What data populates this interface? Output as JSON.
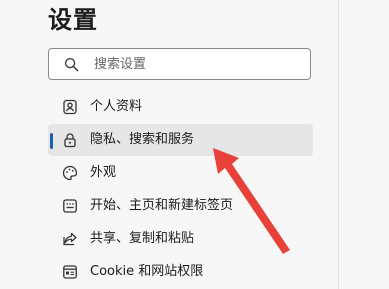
{
  "settings": {
    "title": "设置",
    "search_placeholder": "搜索设置"
  },
  "menu": {
    "items": [
      {
        "label": "个人资料",
        "icon": "profile-icon",
        "active": false
      },
      {
        "label": "隐私、搜索和服务",
        "icon": "lock-icon",
        "active": true
      },
      {
        "label": "外观",
        "icon": "palette-icon",
        "active": false
      },
      {
        "label": "开始、主页和新建标签页",
        "icon": "new-tab-icon",
        "active": false
      },
      {
        "label": "共享、复制和粘贴",
        "icon": "share-icon",
        "active": false
      },
      {
        "label": "Cookie 和网站权限",
        "icon": "site-permissions-icon",
        "active": false
      }
    ]
  },
  "colors": {
    "active_indicator": "#1a5fb4",
    "active_background": "#e6e6e6",
    "annotation_arrow": "#e8413a"
  },
  "annotation": {
    "icon": "red-arrow-icon"
  }
}
